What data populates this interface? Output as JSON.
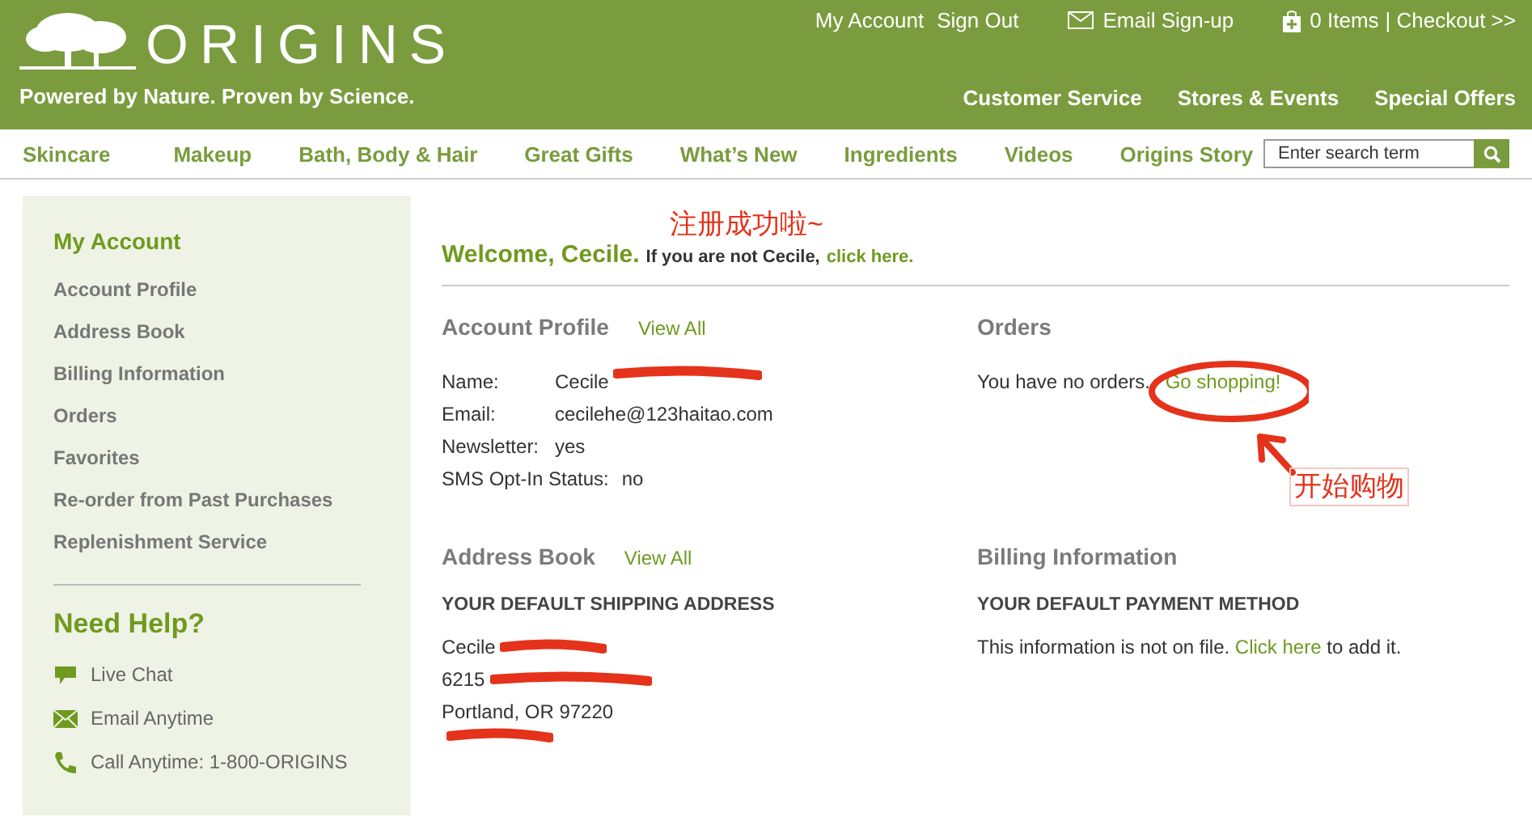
{
  "header": {
    "logo_text": "ORIGINS",
    "tagline": "Powered by Nature. Proven by Science.",
    "top_links": [
      "My Account",
      "Sign Out",
      "Email Sign-up",
      "0 Items",
      "| Checkout >>"
    ],
    "main_links": [
      "Customer Service",
      "Stores & Events",
      "Special Offers"
    ]
  },
  "nav": {
    "items": [
      "Skincare",
      "Makeup",
      "Bath, Body & Hair",
      "Great Gifts",
      "What’s New",
      "Ingredients",
      "Videos",
      "Origins Story"
    ],
    "search": {
      "placeholder": "Enter search term"
    }
  },
  "sidebar": {
    "title": "My Account",
    "items": [
      "Account Profile",
      "Address Book",
      "Billing Information",
      "Orders",
      "Favorites",
      "Re-order from Past Purchases",
      "Replenishment Service"
    ],
    "help_title": "Need Help?",
    "help_items": [
      {
        "label": "Live Chat",
        "kind": "chat"
      },
      {
        "label": "Email Anytime",
        "kind": "email"
      },
      {
        "label": "Call Anytime: 1-800-ORIGINS",
        "kind": "phone"
      }
    ]
  },
  "welcome": {
    "heading": "Welcome, Cecile.",
    "note": "If you are not Cecile,",
    "link": "click here."
  },
  "account_profile": {
    "title": "Account Profile",
    "link": "View All",
    "fields": [
      {
        "label": "Name:",
        "value": "Cecile",
        "redacted": true
      },
      {
        "label": "Email:",
        "value": "cecilehe@123haitao.com",
        "redacted": false
      },
      {
        "label": "Newsletter:",
        "value": "yes",
        "redacted": false
      },
      {
        "label": "SMS Opt-In Status:",
        "value": "no",
        "redacted": false
      }
    ]
  },
  "orders": {
    "title": "Orders",
    "text": "You have no orders.",
    "link": "Go shopping!"
  },
  "address_book": {
    "title": "Address Book",
    "link": "View All",
    "subtitle": "YOUR DEFAULT SHIPPING ADDRESS",
    "lines": [
      {
        "text": "Cecile",
        "redacted": true
      },
      {
        "text": "6215",
        "redacted": true
      },
      {
        "text": "Portland, OR 97220",
        "redacted": false
      },
      {
        "redacted": true
      }
    ]
  },
  "billing": {
    "title": "Billing Information",
    "subtitle": "YOUR DEFAULT PAYMENT METHOD",
    "text_before": "This information is not on file.",
    "link": "Click here",
    "text_after": "to add it."
  },
  "annotations": [
    {
      "kind": "caption",
      "text": "注册成功啦~"
    },
    {
      "kind": "label",
      "text": "开始购物"
    }
  ]
}
